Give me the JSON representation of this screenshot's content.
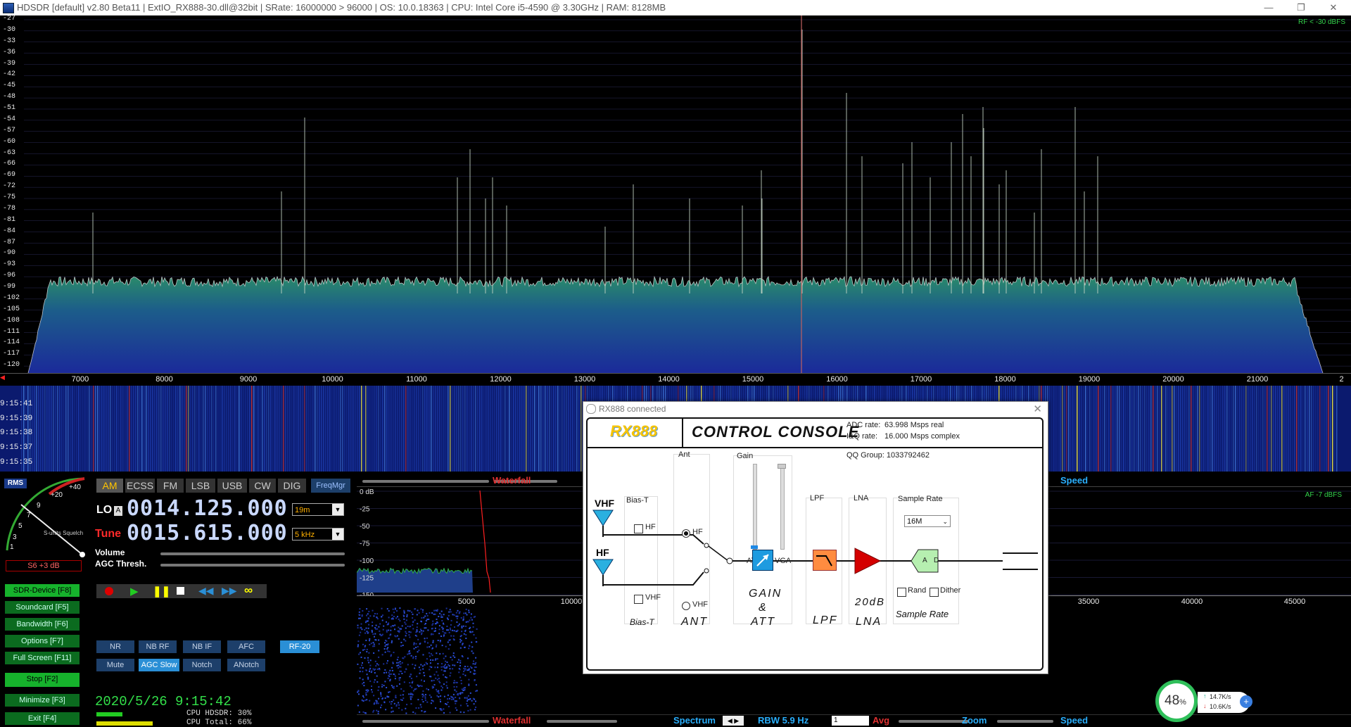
{
  "titlebar": {
    "text": "HDSDR  [default]  v2.80 Beta11   |   ExtIO_RX888-30.dll@32bit   |   SRate: 16000000 > 96000   |   OS: 10.0.18363    |   CPU: Intel Core i5-4590 @ 3.30GHz   |   RAM: 8128MB",
    "minimize": "—",
    "restore": "❐",
    "close": "✕"
  },
  "spectrum": {
    "rf_label": "RF < -30 dBFS",
    "y_ticks": [
      "-27",
      "-30",
      "-33",
      "-36",
      "-39",
      "-42",
      "-45",
      "-48",
      "-51",
      "-54",
      "-57",
      "-60",
      "-63",
      "-66",
      "-69",
      "-72",
      "-75",
      "-78",
      "-81",
      "-84",
      "-87",
      "-90",
      "-93",
      "-96",
      "-99",
      "-102",
      "-105",
      "-108",
      "-111",
      "-114",
      "-117",
      "-120"
    ],
    "freq_ticks": [
      "7000",
      "8000",
      "9000",
      "10000",
      "11000",
      "12000",
      "13000",
      "14000",
      "15000",
      "16000",
      "17000",
      "18000",
      "19000",
      "20000",
      "21000",
      "2"
    ]
  },
  "waterfall": {
    "times": [
      "9:15:41",
      "9:15:39",
      "9:15:38",
      "9:15:37",
      "9:15:35"
    ]
  },
  "smeter": {
    "rms": "RMS",
    "scale_labels": [
      "+40",
      "+20",
      "9",
      "7",
      "5",
      "3",
      "1"
    ],
    "squelch": "S-units Squelch",
    "reading": "S6 +3 dB"
  },
  "modes": [
    "AM",
    "ECSS",
    "FM",
    "LSB",
    "USB",
    "CW",
    "DIG"
  ],
  "freqmgr": "FreqMgr",
  "lo": {
    "label": "LO",
    "a": "A",
    "value": "0014.125.000",
    "band": "19m"
  },
  "tune": {
    "label": "Tune",
    "value": "0015.615.000",
    "step": "5 kHz"
  },
  "volume": "Volume",
  "agc_thresh": "AGC Thresh.",
  "left_buttons": [
    {
      "label": "SDR-Device [F8]"
    },
    {
      "label": "Soundcard [F5]"
    },
    {
      "label": "Bandwidth [F6]"
    },
    {
      "label": "Options [F7]"
    },
    {
      "label": "Full Screen [F11]"
    },
    {
      "label": "Stop [F2]"
    },
    {
      "label": "Minimize [F3]"
    },
    {
      "label": "Exit [F4]"
    }
  ],
  "dsp_row1": [
    "NR",
    "NB RF",
    "NB IF",
    "AFC",
    "RF-20"
  ],
  "dsp_row2": [
    "Mute",
    "AGC Slow",
    "Notch",
    "ANotch"
  ],
  "datetime": "2020/5/26 9:15:42",
  "cpu": {
    "hdsdr": "CPU HDSDR: 30%",
    "total": "CPU Total: 66%"
  },
  "audio": {
    "waterfall_label": "Waterfall",
    "speed_label": "Speed",
    "af_label": "AF -7 dBFS",
    "y_ticks": [
      "0 dB",
      "-25",
      "-50",
      "-75",
      "-100",
      "-125",
      "-150"
    ],
    "x_ticks": [
      "5000",
      "10000",
      "35000",
      "40000",
      "45000"
    ]
  },
  "bottom_bar": {
    "waterfall": "Waterfall",
    "spectrum": "Spectrum",
    "rbw": "RBW  5.9 Hz",
    "avg_value": "1",
    "avg": "Avg",
    "zoom": "Zoom",
    "speed": "Speed"
  },
  "dialog": {
    "title": "RX888 connected",
    "logo": "RX888",
    "heading": "CONTROL CONSOLE",
    "adc_label": "ADC rate:",
    "adc_value": "63.998 Msps real",
    "iq_label": "I&Q rate:",
    "iq_value": "16.000 Msps complex",
    "qq": "QQ Group: 1033792462",
    "ant_group": "Ant",
    "gain_group": "Gain",
    "biast_group": "Bias-T",
    "lpf_group": "LPF",
    "lna_group": "LNA",
    "sr_group": "Sample Rate",
    "vhf": "VHF",
    "hf": "HF",
    "cb_hf": "HF",
    "cb_vhf": "VHF",
    "radio_hf": "HF",
    "radio_vhf": "VHF",
    "att": "ATT",
    "vga": "VGA",
    "sr_value": "16M",
    "rand": "Rand",
    "dither": "Dither",
    "adc_a": "A",
    "adc_d": "D",
    "cap_biast": "Bias-T",
    "cap_ant": "ANT",
    "cap_gain": "GAIN",
    "cap_amp": "&",
    "cap_att": "ATT",
    "cap_lpf": "LPF",
    "cap_lna_db": "20dB",
    "cap_lna": "LNA",
    "cap_sr": "Sample Rate"
  },
  "tray": {
    "percent": "48",
    "pct_sign": "%",
    "up": "14.7K/s",
    "down": "10.6K/s"
  }
}
